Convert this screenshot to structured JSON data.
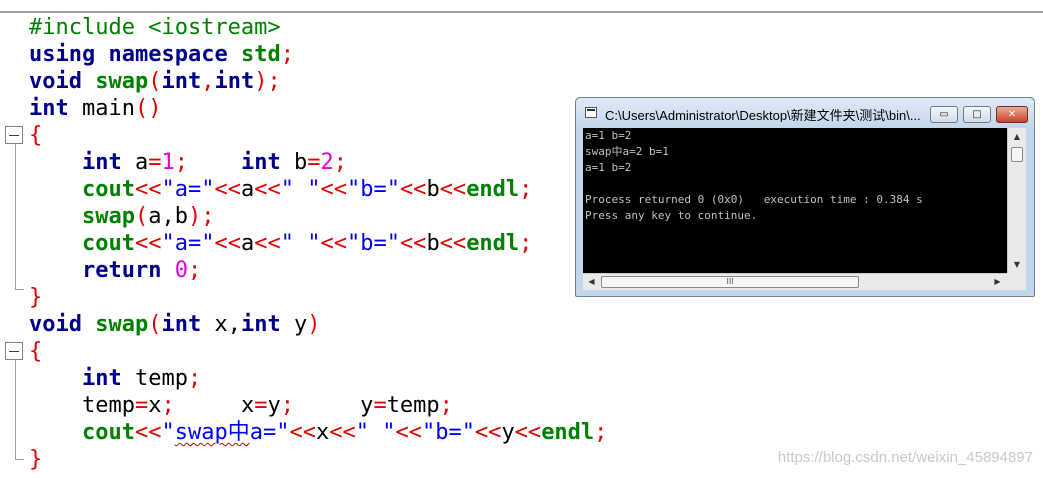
{
  "editor": {
    "lines": [
      [
        "#include <iostream>"
      ],
      [
        "using",
        " ",
        "namespace",
        " ",
        "std",
        ";"
      ],
      [
        "void",
        " ",
        "swap",
        "(",
        "int",
        ",",
        "int",
        ");"
      ],
      [
        "int",
        " main",
        "()"
      ],
      [
        "{"
      ],
      [
        "    ",
        "int",
        " a",
        "=",
        "1",
        ";    ",
        "int",
        " b",
        "=",
        "2",
        ";"
      ],
      [
        "    ",
        "cout",
        "<<",
        "\"a=\"",
        "<<",
        "a",
        "<<",
        "\" \"",
        "<<",
        "\"b=\"",
        "<<",
        "b",
        "<<",
        "endl",
        ";"
      ],
      [
        "    ",
        "swap",
        "(",
        "a,b",
        ");"
      ],
      [
        "    ",
        "cout",
        "<<",
        "\"a=\"",
        "<<",
        "a",
        "<<",
        "\" \"",
        "<<",
        "\"b=\"",
        "<<",
        "b",
        "<<",
        "endl",
        ";"
      ],
      [
        "    ",
        "return",
        " ",
        "0",
        ";"
      ],
      [
        "}"
      ],
      [
        "void",
        " ",
        "swap",
        "(",
        "int",
        " x,",
        "int",
        " y",
        ")"
      ],
      [
        "{"
      ],
      [
        "    ",
        "int",
        " temp",
        ";"
      ],
      [
        "    temp",
        "=",
        "x",
        ";",
        "     x",
        "=",
        "y",
        ";",
        "     y",
        "=",
        "temp",
        ";"
      ],
      [
        "    ",
        "cout",
        "<<",
        "\"",
        "swap中",
        "a=\"",
        "<<",
        "x",
        "<<",
        "\" \"",
        "<<",
        "\"b=\"",
        "<<",
        "y",
        "<<",
        "endl",
        ";"
      ],
      [
        "}"
      ]
    ]
  },
  "console": {
    "title": "C:\\Users\\Administrator\\Desktop\\新建文件夹\\测试\\bin\\...",
    "minimize_glyph": "▭",
    "maximize_glyph": "□",
    "close_glyph": "✕",
    "output": [
      "a=1 b=2",
      "swap中a=2 b=1",
      "a=1 b=2",
      "",
      "Process returned 0 (0x0)   execution time : 0.384 s",
      "Press any key to continue."
    ],
    "scroll_up": "▲",
    "scroll_down": "▼",
    "scroll_left": "◀",
    "scroll_right": "▶",
    "hthumb_grip": "III"
  },
  "watermark": "https://blog.csdn.net/weixin_45894897"
}
